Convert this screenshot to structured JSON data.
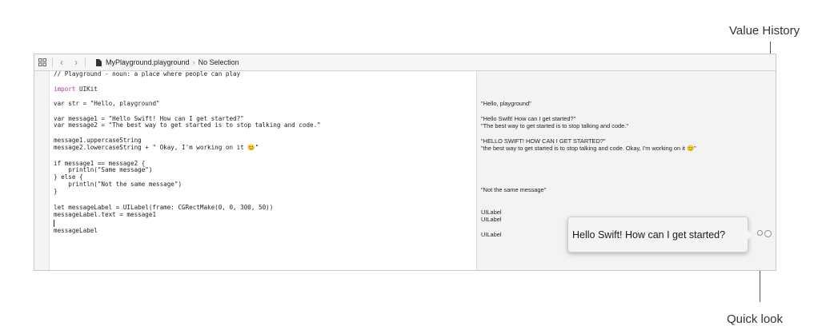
{
  "callouts": {
    "value_history": "Value History",
    "quick_look": "Quick look"
  },
  "jumpbar": {
    "file": "MyPlayground.playground",
    "separator": "›",
    "selection": "No Selection",
    "back_glyph": "‹",
    "forward_glyph": "›"
  },
  "code_lines": {
    "l1": "// Playground - noun: a place where people can play",
    "l2": "import UIKit",
    "l3": "var str = \"Hello, playground\"",
    "l4": "var message1 = \"Hello Swift! How can I get started?\"",
    "l5": "var message2 = \"The best way to get started is to stop talking and code.\"",
    "l6": "message1.uppercaseString",
    "l7": "message2.lowercaseString + \" Okay, I'm working on it 😊\"",
    "l8": "if message1 == message2 {",
    "l9": "    println(\"Same message\")",
    "l10": "} else {",
    "l11": "    println(\"Not the same message\")",
    "l12": "}",
    "l13": "let messageLabel = UILabel(frame: CGRectMake(0, 0, 300, 50))",
    "l14": "messageLabel.text = message1",
    "l15": "messageLabel"
  },
  "results": {
    "r1": "\"Hello, playground\"",
    "r2": "\"Hello Swift! How can I get started?\"",
    "r3": "\"The best way to get started is to stop talking and code.\"",
    "r4": "\"HELLO SWIFT! HOW CAN I GET STARTED?\"",
    "r5": "\"the best way to get started is to stop talking and code. Okay, I'm working on it 😊\"",
    "r6": "\"Not the same message\"",
    "r7": "UILabel",
    "r8": "UILabel",
    "r9": "UILabel"
  },
  "quick_look_bubble": {
    "text": "Hello Swift! How can I get started?"
  },
  "colors": {
    "keyword": "#a8389a",
    "string": "#c41a16",
    "comment": "#1e8a2c",
    "method": "#3e6d76",
    "type": "#6b3fa0"
  },
  "icons": [
    "grid-icon",
    "back-arrow-icon",
    "forward-arrow-icon",
    "playground-file-icon",
    "quick-look-icon",
    "value-history-icon"
  ]
}
